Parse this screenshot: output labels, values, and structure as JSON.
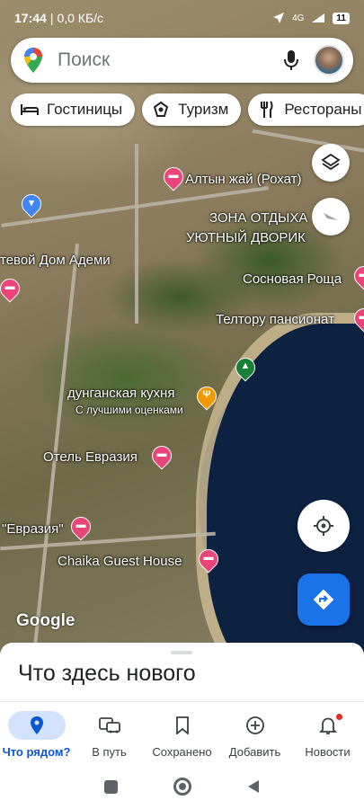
{
  "status_bar": {
    "time": "17:44",
    "speed": "0,0 КБ/с",
    "network": "4G",
    "battery": "11"
  },
  "search": {
    "placeholder": "Поиск",
    "logo_icon": "maps-pin-icon",
    "mic_icon": "mic-icon",
    "avatar_icon": "avatar"
  },
  "chips": [
    {
      "label": "Гостиницы",
      "icon": "bed-icon"
    },
    {
      "label": "Туризм",
      "icon": "camera-icon"
    },
    {
      "label": "Рестораны",
      "icon": "fork-knife-icon"
    }
  ],
  "map": {
    "labels": [
      "Алтын жай (Рохат)",
      "ЗОНА ОТДЫХА",
      "УЮТНЫЙ ДВОРИК",
      "тевой Дом Адеми",
      "Сосновая Роща",
      "Телтору пансионат",
      "дунганская кухня",
      "С лучшими оценками",
      "Отель Евразия",
      "\"Евразия\"",
      "Chaika Guest House"
    ],
    "attribution": "Google",
    "colors": {
      "hotel_pin": "#e8457a",
      "food_pin": "#f29900",
      "park_pin": "#188038",
      "shop_pin": "#4285f4",
      "water": "#0d2141"
    }
  },
  "controls": {
    "layers_icon": "layers-icon",
    "compass_icon": "compass-icon",
    "location_icon": "my-location-icon",
    "directions_icon": "directions-icon"
  },
  "sheet": {
    "title": "Что здесь нового"
  },
  "nav": [
    {
      "label": "Что рядом?",
      "icon": "location-pin-icon",
      "active": true
    },
    {
      "label": "В путь",
      "icon": "commute-icon",
      "active": false
    },
    {
      "label": "Сохранено",
      "icon": "bookmark-icon",
      "active": false
    },
    {
      "label": "Добавить",
      "icon": "add-circle-icon",
      "active": false
    },
    {
      "label": "Новости",
      "icon": "bell-icon",
      "active": false
    }
  ]
}
